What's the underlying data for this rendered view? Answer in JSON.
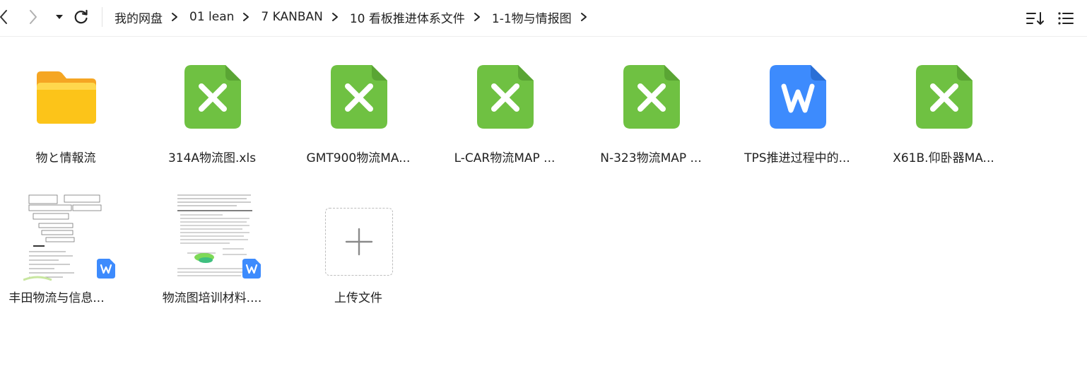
{
  "breadcrumb": [
    "我的网盘",
    "01 lean",
    "7 KANBAN",
    "10 看板推进体系文件",
    "1-1物与情报图"
  ],
  "items": [
    {
      "name": "物と情報流",
      "type": "folder"
    },
    {
      "name": "314A物流图.xls",
      "type": "xls"
    },
    {
      "name": "GMT900物流MA...",
      "type": "xls"
    },
    {
      "name": "L-CAR物流MAP ...",
      "type": "xls"
    },
    {
      "name": "N-323物流MAP ...",
      "type": "xls"
    },
    {
      "name": "TPS推进过程中的...",
      "type": "wps"
    },
    {
      "name": "X61B.仰卧器MA...",
      "type": "xls"
    },
    {
      "name": "丰田物流与信息...",
      "type": "doc-thumb"
    },
    {
      "name": "物流图培训材料....",
      "type": "doc-thumb"
    }
  ],
  "upload": {
    "label": "上传文件"
  },
  "colors": {
    "xls_green": "#6fc142",
    "wps_blue": "#3d8bfd",
    "folder_yellow": "#fcc419"
  },
  "icons": {
    "back": "chevron-left",
    "forward": "chevron-right",
    "dropdown": "caret-down",
    "refresh": "refresh",
    "sort": "sort-icon",
    "view": "list-view-icon"
  }
}
